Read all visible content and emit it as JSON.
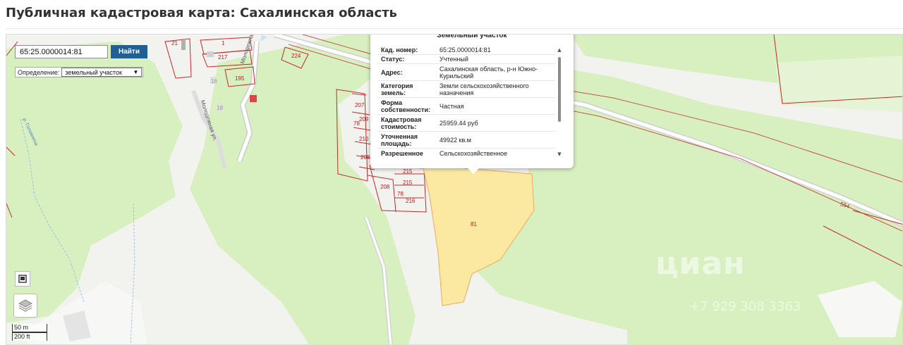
{
  "page": {
    "title": "Публичная кадастровая карта: Сахалинская область"
  },
  "search": {
    "value": "65:25.0000014:81",
    "button_label": "Найти"
  },
  "definition": {
    "label": "Определение:",
    "value": "земельный участок"
  },
  "popup": {
    "title": "Земельный участок",
    "rows": [
      {
        "key": "Кад. номер:",
        "value": "65:25.0000014:81"
      },
      {
        "key": "Статус:",
        "value": "Учтенный"
      },
      {
        "key": "Адрес:",
        "value": "Сахалинская область, р-н Южно-Курильский"
      },
      {
        "key": "Категория земель:",
        "value": "Земли сельскохозяйственного назначения"
      },
      {
        "key": "Форма собственности:",
        "value": "Частная"
      },
      {
        "key": "Кадастровая стоимость:",
        "value": "25959.44 руб"
      },
      {
        "key": "Уточненная площадь:",
        "value": "49922 кв.м"
      },
      {
        "key": "Разрешенное",
        "value": "Сельскохозяйственное"
      }
    ]
  },
  "map": {
    "parcel_labels": [
      "21",
      "1",
      "217",
      "224",
      "195",
      "16",
      "18",
      "207",
      "209",
      "78",
      "210",
      "208",
      "215",
      "215",
      "208",
      "78",
      "216",
      "81",
      "554"
    ],
    "streets": [
      "Молодежная ул.",
      "Молодежная ул."
    ],
    "river": "р. Головнина",
    "colors": {
      "forest": "#d8f0c0",
      "parcel_fill": "#fbe9a2",
      "parcel_border": "#c62828",
      "background": "#f2f2ef"
    }
  },
  "scale": {
    "metric": "50 m",
    "imperial": "200 ft"
  },
  "watermark": {
    "brand": "циан",
    "phone": "+7 929 308 3363"
  }
}
